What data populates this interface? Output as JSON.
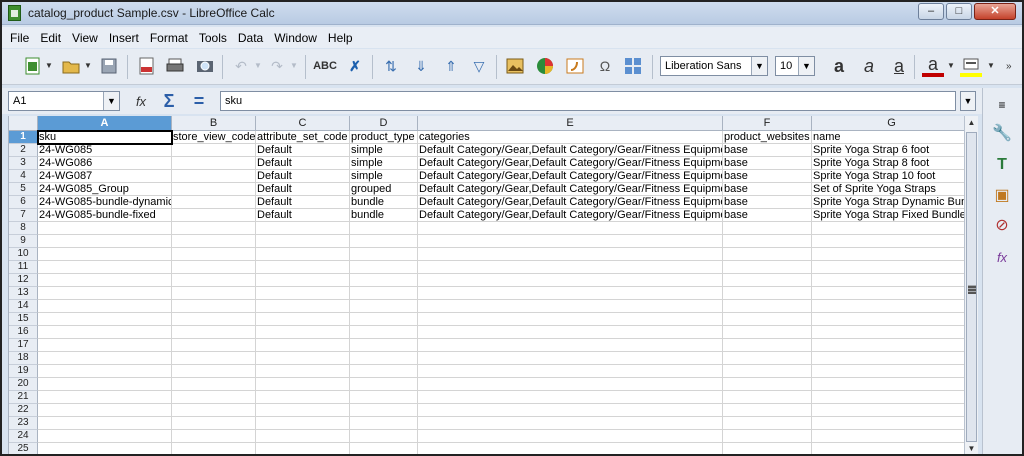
{
  "window": {
    "title": "catalog_product Sample.csv - LibreOffice Calc",
    "minimize": "–",
    "maximize": "□",
    "close": "✕"
  },
  "menu": [
    "File",
    "Edit",
    "View",
    "Insert",
    "Format",
    "Tools",
    "Data",
    "Window",
    "Help"
  ],
  "toolbar": {
    "font_name": "Liberation Sans",
    "font_size": "10",
    "icons": [
      "new-icon",
      "open-icon",
      "save-icon",
      "export-pdf-icon",
      "print-icon",
      "print-preview-icon",
      "undo-icon",
      "redo-icon",
      "spellcheck-icon",
      "autocorrect-icon",
      "sort-icon",
      "sort-ascending-icon",
      "sort-descending-icon",
      "autofilter-icon",
      "image-icon",
      "chart-icon",
      "pivot-table-icon",
      "special-character-icon",
      "hyperlink-icon",
      "bold-icon",
      "italic-icon",
      "underline-icon",
      "font-color-icon",
      "highlight-icon"
    ],
    "colors": {
      "font_color": "#c00000",
      "highlight": "#ffff00",
      "accent": "#5b9bd5"
    }
  },
  "formula_bar": {
    "name_box": "A1",
    "content": "sku"
  },
  "sheet": {
    "columns": [
      "A",
      "B",
      "C",
      "D",
      "E",
      "F",
      "G"
    ],
    "row_numbers": [
      "1",
      "2",
      "3",
      "4",
      "5",
      "6",
      "7",
      "8",
      "9",
      "10",
      "11",
      "12",
      "13",
      "14",
      "15",
      "16",
      "17",
      "18",
      "19",
      "20",
      "21",
      "22",
      "23",
      "24",
      "25"
    ],
    "rows": [
      [
        "sku",
        "store_view_code",
        "attribute_set_code",
        "product_type",
        "categories",
        "product_websites",
        "name"
      ],
      [
        "24-WG085",
        "",
        "Default",
        "simple",
        "Default Category/Gear,Default Category/Gear/Fitness Equipment",
        "base",
        "Sprite Yoga Strap 6 foot"
      ],
      [
        "24-WG086",
        "",
        "Default",
        "simple",
        "Default Category/Gear,Default Category/Gear/Fitness Equipment",
        "base",
        "Sprite Yoga Strap 8 foot"
      ],
      [
        "24-WG087",
        "",
        "Default",
        "simple",
        "Default Category/Gear,Default Category/Gear/Fitness Equipment",
        "base",
        "Sprite Yoga Strap 10 foot"
      ],
      [
        "24-WG085_Group",
        "",
        "Default",
        "grouped",
        "Default Category/Gear,Default Category/Gear/Fitness Equipment",
        "base",
        "Set of Sprite Yoga Straps"
      ],
      [
        "24-WG085-bundle-dynamic",
        "",
        "Default",
        "bundle",
        "Default Category/Gear,Default Category/Gear/Fitness Equipment",
        "base",
        "Sprite Yoga Strap Dynamic Bundle"
      ],
      [
        "24-WG085-bundle-fixed",
        "",
        "Default",
        "bundle",
        "Default Category/Gear,Default Category/Gear/Fitness Equipment",
        "base",
        "Sprite Yoga Strap Fixed Bundle"
      ]
    ]
  },
  "sidebar_icons": [
    "properties-icon",
    "styles-icon",
    "gallery-icon",
    "navigator-icon",
    "functions-icon"
  ]
}
